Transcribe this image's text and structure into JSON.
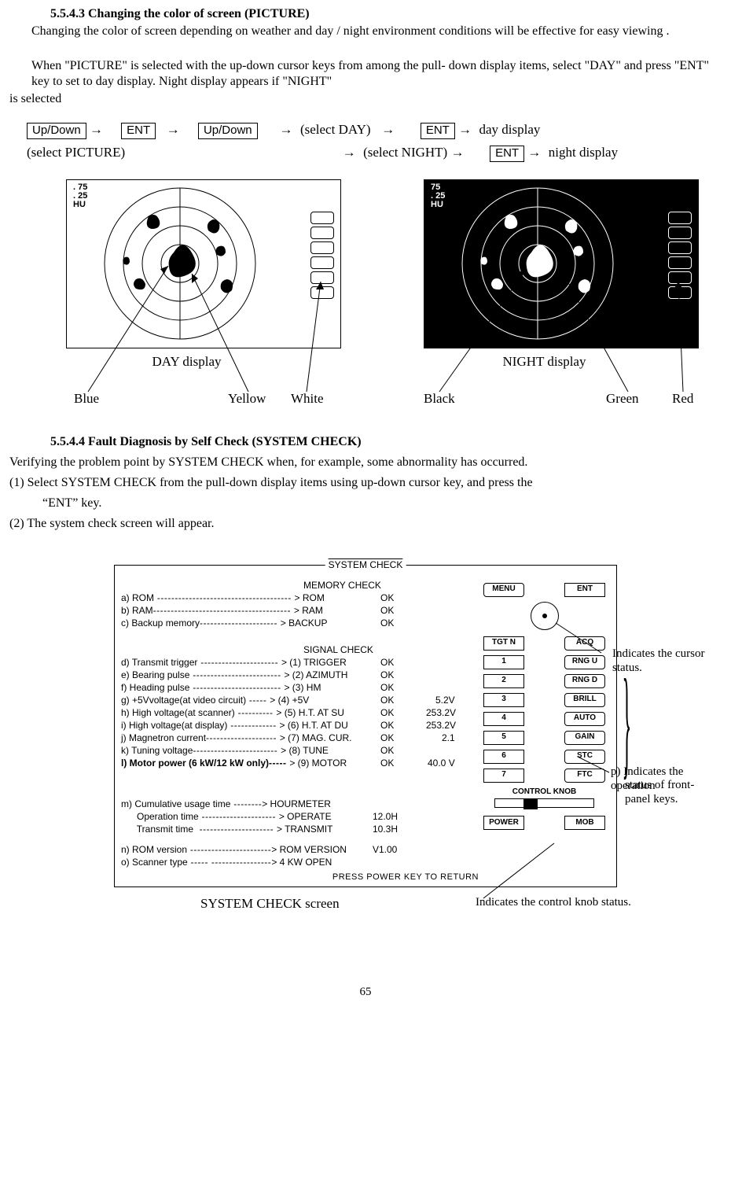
{
  "page_number": "65",
  "section543": {
    "heading": "5.5.4.3 Changing the color of screen (PICTURE)",
    "para1": "Changing the color of screen depending on weather and day / night environment conditions will be effective for easy viewing .",
    "para2": "When \"PICTURE\" is selected with the up-down cursor keys from among the pull- down display items, select \"DAY\" and press \"ENT\" key to set to day display. Night display appears if \"NIGHT\"",
    "para3": "is selected",
    "flow": {
      "updown": "Up/Down",
      "ent": "ENT",
      "select_picture": "(select PICTURE)",
      "select_day": "(select DAY)",
      "select_night": "(select NIGHT)",
      "day_display": "day display",
      "night_display": "night display"
    },
    "radar_label_75": ". 75",
    "radar_label_25": ". 25",
    "radar_label_hu": "HU",
    "radar_label_75n": "75",
    "day_caption": "DAY display",
    "night_caption": "NIGHT display",
    "callouts": {
      "blue": "Blue",
      "yellow": "Yellow",
      "white": "White",
      "black": "Black",
      "green": "Green",
      "red": "Red"
    }
  },
  "section544": {
    "heading": "5.5.4.4 Fault Diagnosis by Self Check (SYSTEM CHECK)",
    "intro": "Verifying the problem point by SYSTEM CHECK when, for example, some abnormality has occurred.",
    "step1": "(1) Select SYSTEM CHECK from the pull-down display items using up-down cursor key, and press the",
    "step1b": "“ENT” key.",
    "step2": "(2) The system check screen will appear."
  },
  "syschk": {
    "title": "SYSTEM CHECK",
    "mem_title": "MEMORY CHECK",
    "sig_title": "SIGNAL CHECK",
    "rows": {
      "a": {
        "l": "a) ROM",
        "m": "> ROM",
        "r": "OK",
        "v": ""
      },
      "b": {
        "l": "b) RAM",
        "m": "> RAM",
        "r": "OK",
        "v": ""
      },
      "c": {
        "l": "c) Backup memory",
        "m": "> BACKUP",
        "r": "OK",
        "v": ""
      },
      "d": {
        "l": "d) Transmit trigger",
        "m": "> (1) TRIGGER",
        "r": "OK",
        "v": ""
      },
      "e": {
        "l": "e) Bearing pulse",
        "m": "> (2) AZIMUTH",
        "r": "OK",
        "v": ""
      },
      "f": {
        "l": "f) Heading pulse",
        "m": "> (3) HM",
        "r": "OK",
        "v": ""
      },
      "g": {
        "l": "g) +5Vvoltage(at video circuit)",
        "m": "> (4) +5V",
        "r": "OK",
        "v": "5.2V"
      },
      "h": {
        "l": "h) High voltage(at scanner)",
        "m": "> (5) H.T. AT SU",
        "r": "OK",
        "v": "253.2V"
      },
      "i": {
        "l": "i) High voltage(at display)",
        "m": "> (6) H.T. AT DU",
        "r": "OK",
        "v": "253.2V"
      },
      "j": {
        "l": "j) Magnetron current",
        "m": "> (7) MAG. CUR.",
        "r": "OK",
        "v": "2.1"
      },
      "k": {
        "l": "k) Tuning voltage",
        "m": "> (8) TUNE",
        "r": "OK",
        "v": ""
      },
      "l": {
        "l": "l) Motor power (6 kW/12 kW only)",
        "m": "> (9) MOTOR",
        "r": "OK",
        "v": "40.0 V"
      },
      "m1": {
        "l": "m) Cumulative usage time",
        "m": "> HOURMETER",
        "r": "",
        "v": ""
      },
      "m2": {
        "l": "      Operation time",
        "m": "> OPERATE",
        "r": "12.0H",
        "v": ""
      },
      "m3": {
        "l": "      Transmit time",
        "m": "> TRANSMIT",
        "r": "10.3H",
        "v": ""
      },
      "n": {
        "l": "n) ROM version",
        "m": "> ROM VERSION",
        "r": "V1.00",
        "v": ""
      },
      "o": {
        "l": "o) Scanner type",
        "m": "> 4 KW OPEN",
        "r": "",
        "v": ""
      }
    },
    "press_return": "PRESS POWER KEY TO RETURN",
    "panel": {
      "menu": "MENU",
      "ent": "ENT",
      "tgtn": "TGT N",
      "acq": "ACQ",
      "1": "1",
      "rngu": "RNG U",
      "2": "2",
      "rngd": "RNG D",
      "3": "3",
      "brill": "BRILL",
      "4": "4",
      "auto": "AUTO",
      "5": "5",
      "gain": "GAIN",
      "6": "6",
      "stc": "STC",
      "7": "7",
      "ftc": "FTC",
      "ctrl": "CONTROL KNOB",
      "power": "POWER",
      "mob": "MOB"
    },
    "notes": {
      "cursor": "Indicates the cursor status.",
      "keys_a": "p) Indicates the operation",
      "keys_b": "status of front-panel keys.",
      "knob": "Indicates the control knob status."
    },
    "caption": "SYSTEM CHECK screen"
  }
}
